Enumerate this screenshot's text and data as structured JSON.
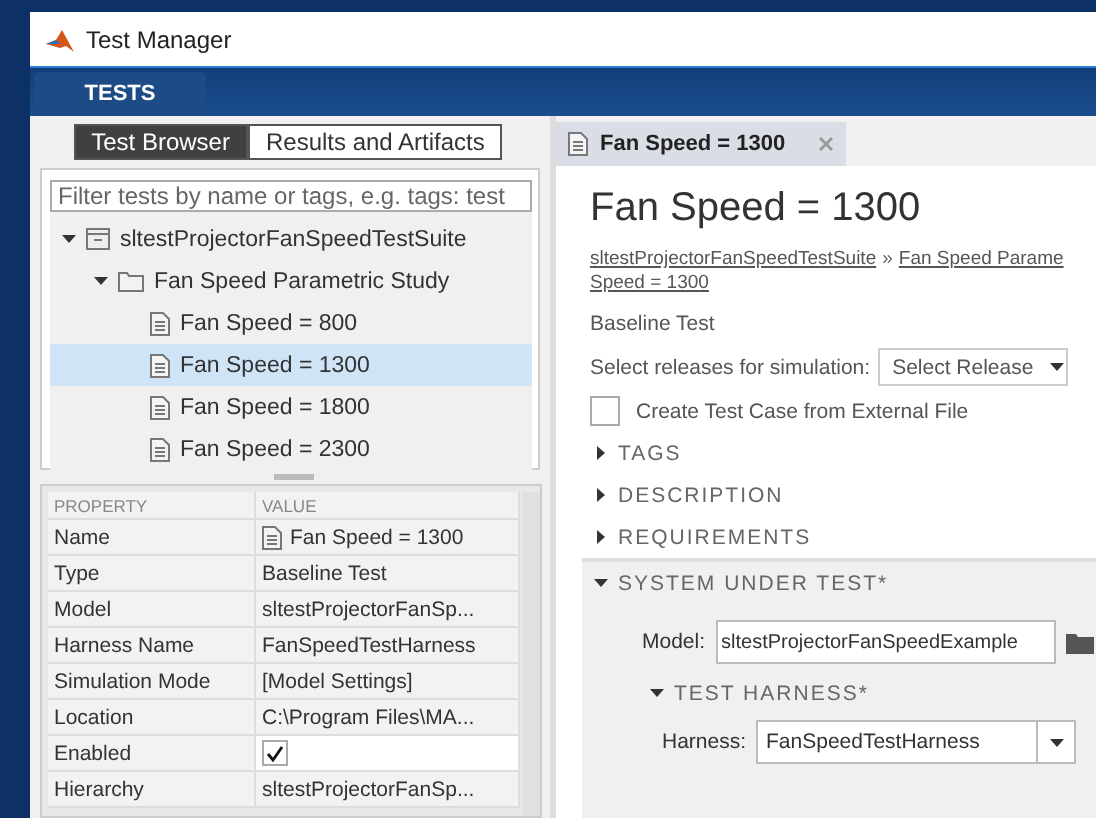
{
  "window": {
    "title": "Test Manager"
  },
  "toolstrip": {
    "tabs": [
      {
        "label": "TESTS",
        "selected": true
      }
    ]
  },
  "left": {
    "tabs": [
      {
        "label": "Test Browser",
        "selected": true
      },
      {
        "label": "Results and Artifacts",
        "selected": false
      }
    ],
    "filter": {
      "placeholder": "Filter tests by name or tags, e.g. tags: test"
    },
    "tree": [
      {
        "label": "sltestProjectorFanSpeedTestSuite",
        "kind": "suite",
        "expanded": true,
        "selected": false,
        "children": [
          {
            "label": "Fan Speed Parametric Study",
            "kind": "folder",
            "expanded": true,
            "selected": false,
            "children": [
              {
                "label": "Fan Speed = 800",
                "kind": "test",
                "selected": false
              },
              {
                "label": "Fan Speed = 1300",
                "kind": "test",
                "selected": true
              },
              {
                "label": "Fan Speed = 1800",
                "kind": "test",
                "selected": false
              },
              {
                "label": "Fan Speed = 2300",
                "kind": "test",
                "selected": false
              }
            ]
          }
        ]
      }
    ],
    "properties": {
      "columns": [
        "PROPERTY",
        "VALUE"
      ],
      "rows": [
        {
          "name": "Name",
          "kind": "icon-text",
          "value": "Fan Speed = 1300"
        },
        {
          "name": "Type",
          "kind": "text",
          "value": "Baseline Test"
        },
        {
          "name": "Model",
          "kind": "text",
          "value": "sltestProjectorFanSp..."
        },
        {
          "name": "Harness Name",
          "kind": "text",
          "value": "FanSpeedTestHarness"
        },
        {
          "name": "Simulation Mode",
          "kind": "text",
          "value": "[Model Settings]"
        },
        {
          "name": "Location",
          "kind": "text",
          "value": "C:\\Program Files\\MA..."
        },
        {
          "name": "Enabled",
          "kind": "checkbox",
          "checked": true
        },
        {
          "name": "Hierarchy",
          "kind": "text",
          "value": "sltestProjectorFanSp..."
        }
      ]
    }
  },
  "right": {
    "tabs": [
      {
        "label": "Fan Speed = 1300",
        "selected": true
      }
    ],
    "title": "Fan Speed = 1300",
    "breadcrumb_lines": [
      [
        "sltestProjectorFanSpeedTestSuite",
        "Fan Speed Parame"
      ],
      [
        "Speed = 1300"
      ]
    ],
    "separator": "»",
    "test_type": "Baseline Test",
    "release": {
      "label": "Select releases for simulation:",
      "value": "Select Release"
    },
    "external_file": {
      "label": "Create Test Case from External File",
      "checked": false
    },
    "sections": [
      {
        "label": "TAGS",
        "expanded": false
      },
      {
        "label": "DESCRIPTION",
        "expanded": false
      },
      {
        "label": "REQUIREMENTS",
        "expanded": false
      },
      {
        "label": "SYSTEM UNDER TEST*",
        "expanded": true,
        "model": {
          "label": "Model:",
          "value": "sltestProjectorFanSpeedExample"
        },
        "subsection": {
          "label": "TEST HARNESS*",
          "expanded": true,
          "harness": {
            "label": "Harness:",
            "value": "FanSpeedTestHarness"
          }
        }
      }
    ]
  }
}
